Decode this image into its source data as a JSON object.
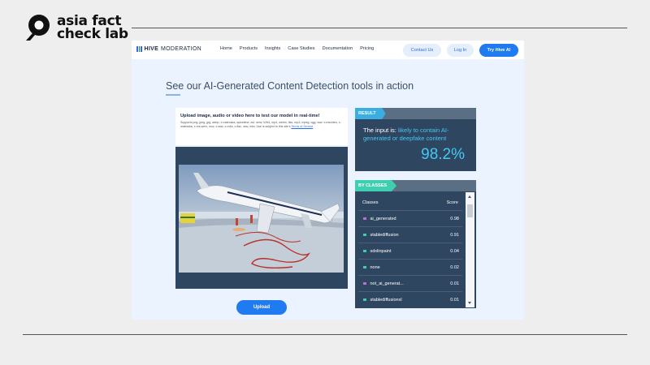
{
  "brand": {
    "line1": "asia fact",
    "line2": "check lab"
  },
  "site": {
    "logo_bold": "HIVE",
    "logo_rest": "MODERATION",
    "nav": [
      "Home",
      "Products",
      "Insights",
      "Case Studies",
      "Documentation",
      "Pricing"
    ],
    "contact_label": "Contact Us",
    "login_label": "Log In",
    "try_label": "Try Hive AI"
  },
  "headline": "See our AI-Generated Content Detection tools in action",
  "upload": {
    "title": "Upload image, audio or video here to test our model in real-time!",
    "supports": "Supports png, jpeg, jpg, webp, x-matroska, quicktime, avi, wmv, h264, mp4, webm, flac, mp3, mpeg, ogg, wav, x-msvideo, x-matroska, x-ms-wmv, mov, x-wav, x-m4a, x-flac, wav, mkv. Use is subject to this site's",
    "tos": "Terms of Service",
    "button_label": "Upload"
  },
  "result": {
    "tag": "RESULT",
    "prefix": "The input is: ",
    "verdict": "likely to contain AI-generated or deepfake content",
    "score": "98.2%"
  },
  "classes": {
    "tag": "BY CLASSES",
    "col_class": "Classes",
    "col_score": "Score",
    "rows": [
      {
        "name": "ai_generated",
        "score": "0.98",
        "color": "#c46ad6"
      },
      {
        "name": "stablediffusion",
        "score": "0.91",
        "color": "#3ecfb0"
      },
      {
        "name": "sdxlinpaint",
        "score": "0.04",
        "color": "#3ecfb0"
      },
      {
        "name": "none",
        "score": "0.02",
        "color": "#3ecfb0"
      },
      {
        "name": "not_ai_generat...",
        "score": "0.01",
        "color": "#c46ad6"
      },
      {
        "name": "stablediffusionxl",
        "score": "0.01",
        "color": "#3ecfb0"
      }
    ]
  },
  "colors": {
    "accent": "#1f7bef",
    "panel": "#2f4660",
    "highlight": "#44c8f5"
  }
}
